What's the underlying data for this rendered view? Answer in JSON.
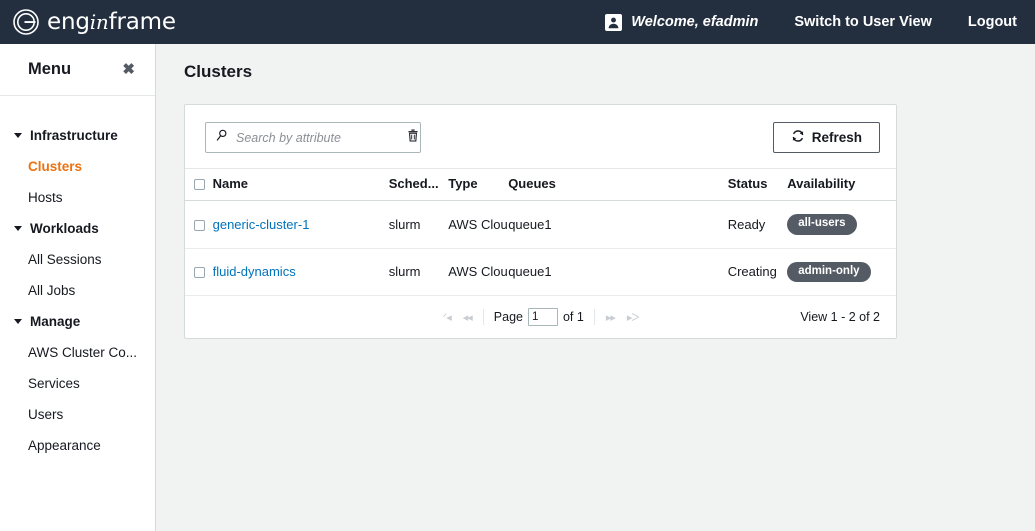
{
  "header": {
    "logo_text_a": "eng",
    "logo_text_in": "in",
    "logo_text_b": "frame",
    "logo_icon": "enginframe-logo-icon",
    "user_icon": "user-avatar-icon",
    "welcome": "Welcome, efadmin",
    "switch_view": "Switch to User View",
    "logout": "Logout",
    "bg_color": "#232f3e"
  },
  "sidebar": {
    "title": "Menu",
    "close_icon": "✖",
    "groups": [
      {
        "label": "Infrastructure",
        "items": [
          {
            "label": "Clusters",
            "active": true
          },
          {
            "label": "Hosts",
            "active": false
          }
        ]
      },
      {
        "label": "Workloads",
        "items": [
          {
            "label": "All Sessions",
            "active": false
          },
          {
            "label": "All Jobs",
            "active": false
          }
        ]
      },
      {
        "label": "Manage",
        "items": [
          {
            "label": "AWS Cluster Co...",
            "active": false
          },
          {
            "label": "Services",
            "active": false
          },
          {
            "label": "Users",
            "active": false
          },
          {
            "label": "Appearance",
            "active": false
          }
        ]
      }
    ],
    "active_color": "#ec7211"
  },
  "main": {
    "page_title": "Clusters",
    "toolbar": {
      "search_placeholder": "Search by attribute",
      "search_value": "",
      "search_icon": "search-icon",
      "clear_icon": "trash-icon",
      "refresh_label": "Refresh",
      "refresh_icon": "refresh-icon"
    },
    "table": {
      "columns": [
        "Name",
        "Sched...",
        "Type",
        "Queues",
        "Status",
        "Availability"
      ],
      "rows": [
        {
          "name": "generic-cluster-1",
          "scheduler": "slurm",
          "type": "AWS Clou",
          "queues": "queue1",
          "status": "Ready",
          "availability": "all-users"
        },
        {
          "name": "fluid-dynamics",
          "scheduler": "slurm",
          "type": "AWS Clou",
          "queues": "queue1",
          "status": "Creating",
          "availability": "admin-only"
        }
      ],
      "badge_color": "#545b64",
      "link_color": "#0073bb"
    },
    "pager": {
      "first_icon": "ᐟ◂",
      "prev_icon": "◂◂",
      "page_label": "Page",
      "page_value": "1",
      "of_label": "of 1",
      "next_icon": "▸▸",
      "last_icon": "▸ᐳ",
      "view_count": "View 1 - 2 of 2"
    }
  }
}
